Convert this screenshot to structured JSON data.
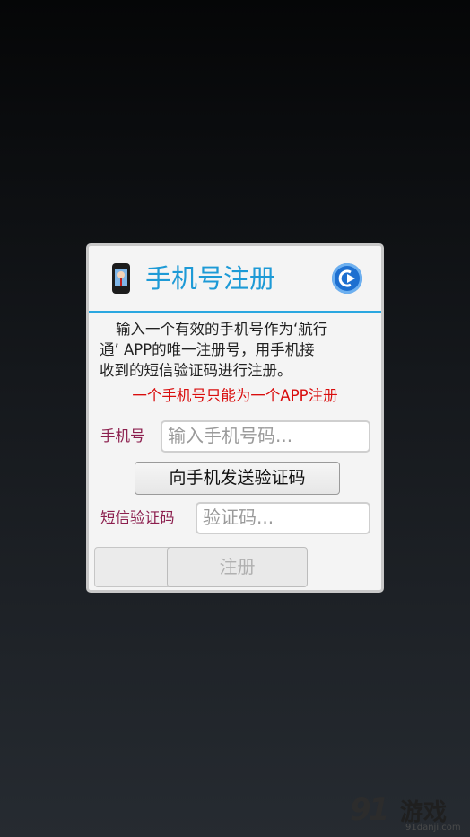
{
  "dialog": {
    "title": "手机号注册",
    "description": [
      "输入一个有效的手机号作为‘航行",
      "通’ APP的唯一注册号，用手机接",
      "收到的短信验证码进行注册。"
    ],
    "warning": "一个手机号只能为一个APP注册",
    "phone_label": "手机号",
    "phone_placeholder": "输入手机号码...",
    "send_code_button": "向手机发送验证码",
    "sms_label": "短信验证码",
    "sms_placeholder": "验证码...",
    "register_button": "注册"
  },
  "watermark": {
    "number": "91",
    "text": "游戏",
    "sub": "91danji.com"
  },
  "colors": {
    "accent": "#1d9ad6",
    "warning": "#d90d0d",
    "label": "#8c1f4e"
  },
  "icons": {
    "title_icon": "phone-icon",
    "back": "back-arrow-icon"
  }
}
